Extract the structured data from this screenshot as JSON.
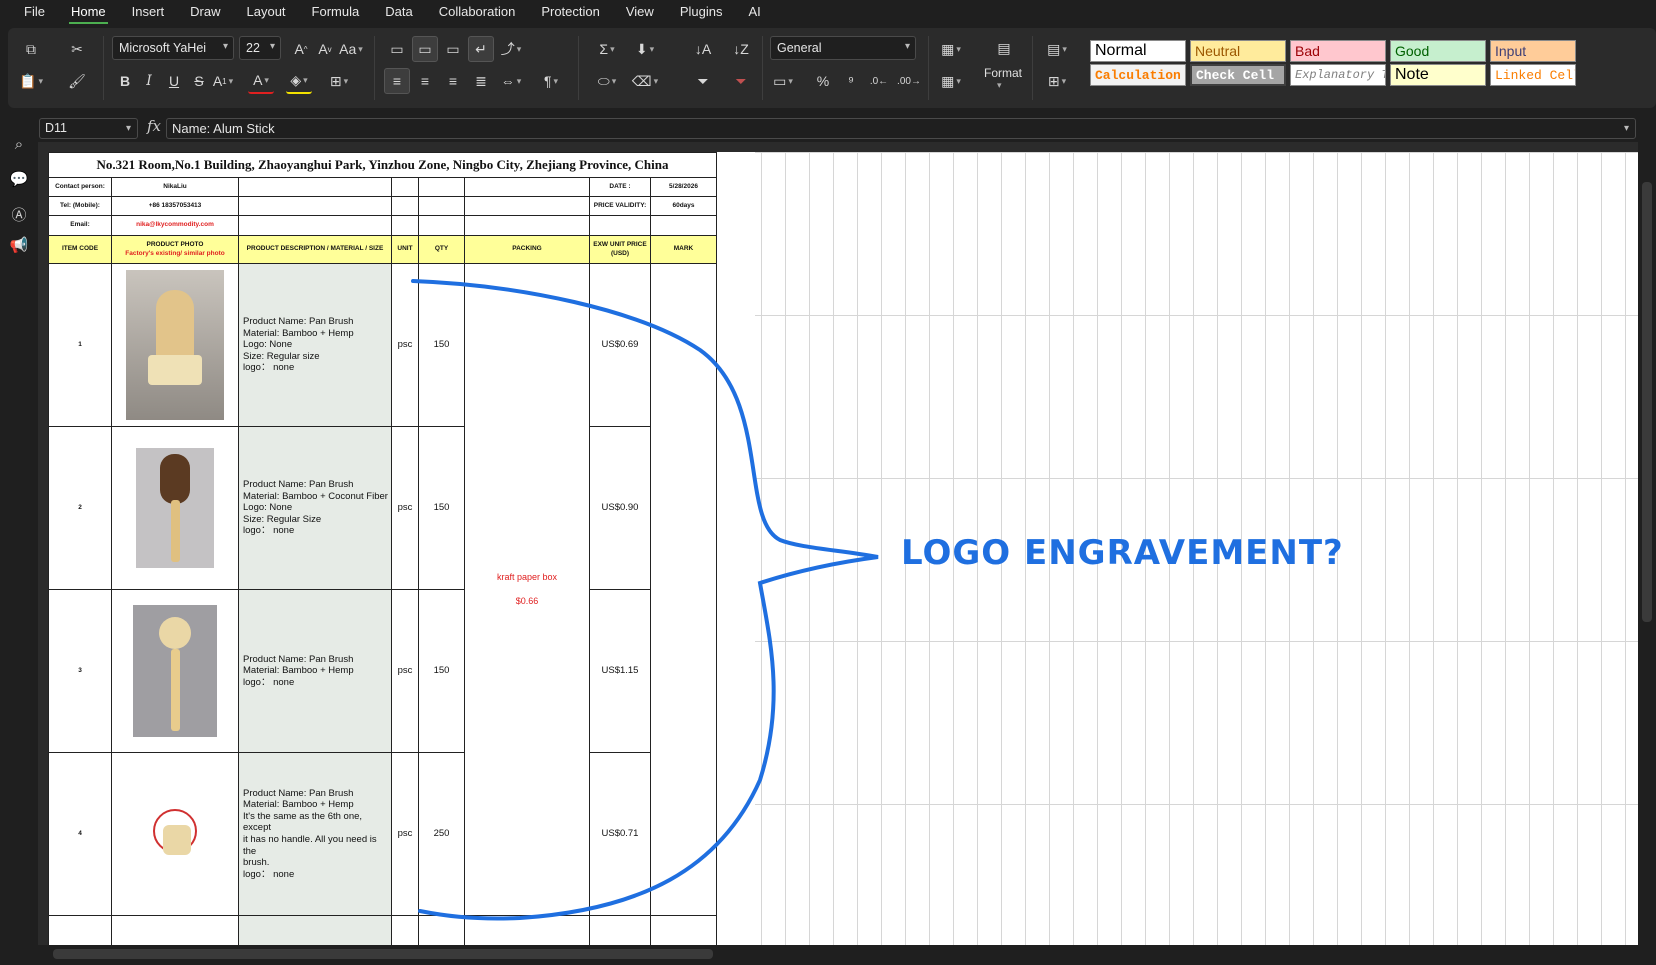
{
  "menu": [
    "File",
    "Home",
    "Insert",
    "Draw",
    "Layout",
    "Formula",
    "Data",
    "Collaboration",
    "Protection",
    "View",
    "Plugins",
    "AI"
  ],
  "menu_active": "Home",
  "ribbon": {
    "font_name": "Microsoft YaHei",
    "font_size": "22",
    "number_format": "General",
    "format_label": "Format"
  },
  "styles": {
    "normal": "Normal",
    "neutral": "Neutral",
    "bad": "Bad",
    "good": "Good",
    "input": "Input",
    "calculation": "Calculation",
    "check_cell": "Check Cell",
    "explanatory": "Explanatory Te",
    "note": "Note",
    "linked_cell": "Linked Cell"
  },
  "formula_bar": {
    "cell_ref": "D11",
    "fx": "fx",
    "content": "Name: Alum Stick"
  },
  "quote": {
    "address": "No.321 Room,No.1 Building, Zhaoyanghui Park, Yinzhou Zone, Ningbo City, Zhejiang Province, China",
    "contact_label": "Contact person:",
    "contact_value": "NikaLiu",
    "tel_label": "Tel: (Mobile):",
    "tel_value": "+86 18357053413",
    "email_label": "Email:",
    "email_value": "nika@lkycommodity.com",
    "date_label": "DATE :",
    "date_value": "5/28/2026",
    "validity_label": "PRICE VALIDITY:",
    "validity_value": "60days",
    "headers": {
      "item_code": "ITEM CODE",
      "photo": "PRODUCT PHOTO",
      "photo_sub": "Factory's existing/ similar photo",
      "desc": "PRODUCT DESCRIPTION / MATERIAL / SIZE",
      "unit": "UNIT",
      "qty": "QTY",
      "packing": "PACKING",
      "price": "EXW UNIT PRICE (USD)",
      "mark": "MARK"
    },
    "packing_text": "kraft paper box",
    "packing_price": "$0.66",
    "rows": [
      {
        "code": "1",
        "desc": [
          "Product Name: Pan Brush",
          "Material: Bamboo + Hemp",
          "Logo: None",
          "Size: Regular size",
          "logo： none"
        ],
        "unit": "psc",
        "qty": "150",
        "price": "US$0.69"
      },
      {
        "code": "2",
        "desc": [
          "Product Name: Pan Brush",
          "Material: Bamboo + Coconut Fiber",
          "Logo: None",
          "Size: Regular Size",
          "logo： none"
        ],
        "unit": "psc",
        "qty": "150",
        "price": "US$0.90"
      },
      {
        "code": "3",
        "desc": [
          "Product Name: Pan Brush",
          "Material: Bamboo + Hemp",
          "logo： none"
        ],
        "unit": "psc",
        "qty": "150",
        "price": "US$1.15"
      },
      {
        "code": "4",
        "desc": [
          "Product Name: Pan Brush",
          "Material: Bamboo + Hemp",
          "It's the same as the 6th one, except",
          "it has no handle. All you need is the",
          "brush.",
          "logo： none"
        ],
        "unit": "psc",
        "qty": "250",
        "price": "US$0.71"
      }
    ]
  },
  "annotation": {
    "text": "LOGO ENGRAVEMENT?",
    "color": "#1f6fe0"
  },
  "colors": {
    "accent": "#4caf50",
    "header_yellow": "#ffff99",
    "desc_bg": "#e6ebe6",
    "red": "#e02020"
  }
}
